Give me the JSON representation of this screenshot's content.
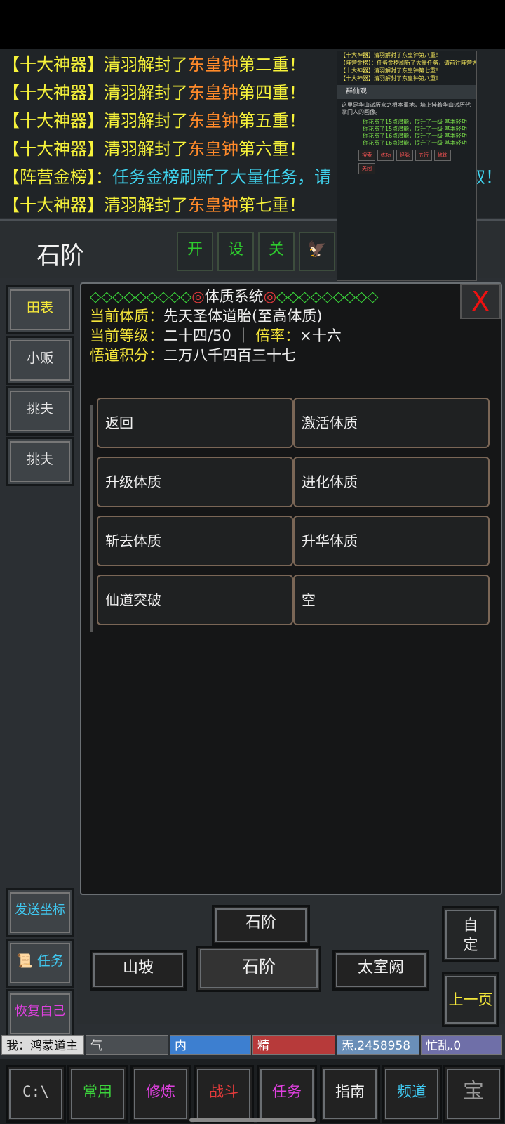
{
  "chat": {
    "lines": [
      {
        "prefix": "【十大神器】清羽解封了",
        "item": "东皇钟",
        "suffix": "第二重！"
      },
      {
        "prefix": "【十大神器】清羽解封了",
        "item": "东皇钟",
        "suffix": "第四重！"
      },
      {
        "prefix": "【十大神器】清羽解封了",
        "item": "东皇钟",
        "suffix": "第五重！"
      },
      {
        "prefix": "【十大神器】清羽解封了",
        "item": "东皇钟",
        "suffix": "第六重！"
      },
      {
        "prefix": "【阵营金榜】：",
        "item": "任务金榜刷新了大量任务，请",
        "suffix": "取！"
      },
      {
        "prefix": "【十大神器】清羽解封了",
        "item": "东皇钟",
        "suffix": "第七重！"
      }
    ]
  },
  "mini": {
    "rows": [
      "【十大神器】清羽解封了东皇钟第八重！",
      "【阵营金榜】：任务金榜刷新了大量任务，请前往阵营大厅接取！",
      "【十大神器】清羽解封了东皇钟第七重！",
      "【十大神器】清羽解封了东皇钟第八重！"
    ],
    "title": "群仙观",
    "desc": "这里是华山派历来之根本重地，墙上挂着华山派历代掌门人的画像。",
    "green": [
      "你花费了15点潜能，提升了一级 基本轻功",
      "你花费了15点潜能，提升了一级 基本轻功",
      "你花费了16点潜能，提升了一级 基本轻功",
      "你花费了16点潜能，提升了一级 基本轻功"
    ],
    "buttons": [
      "搜索",
      "练功",
      "经脉",
      "五行",
      "修炼",
      "关闭"
    ]
  },
  "location": {
    "title": "石阶",
    "buttons": [
      "开",
      "设",
      "关"
    ]
  },
  "sidebar": {
    "items": [
      "田表",
      "小贩",
      "挑夫",
      "挑夫"
    ],
    "bottom": [
      "发送坐标",
      "任务",
      "恢复自己"
    ]
  },
  "panel": {
    "header": {
      "diamonds_left": "◇◇◇◇◇◇◇◇◇",
      "circle": "◎",
      "title": "体质系统",
      "diamonds_right": "◇◇◇◇◇◇◇◇◇"
    },
    "close": "X",
    "lines": [
      {
        "label": "当前体质：",
        "value": "先天圣体道胎(至高体质)"
      },
      {
        "label": "当前等级：",
        "value": "二十四/50 ｜ ",
        "label2": "倍率：",
        "value2": "×十六"
      },
      {
        "label": "悟道积分：",
        "value": "二万八千四百三十七"
      }
    ],
    "buttons": [
      "返回",
      "激活体质",
      "升级体质",
      "进化体质",
      "斩去体质",
      "升华体质",
      "仙道突破",
      "空"
    ]
  },
  "nav": {
    "north": "石阶",
    "west": "山坡",
    "center": "石阶",
    "east": "太室阙"
  },
  "right": {
    "custom": "自\n定",
    "prev": "上一页"
  },
  "stats": {
    "me": "我：鸿蒙道主",
    "qi": "气",
    "nei": "内",
    "jing": "精",
    "money": "炁.2458958",
    "busy": "忙乱.0"
  },
  "bottom": {
    "cmd": "C:\\",
    "buttons": [
      "常用",
      "修炼",
      "战斗",
      "任务",
      "指南",
      "频道"
    ],
    "last": "宝"
  },
  "colors": {
    "yellow": "#f6f23a",
    "orange": "#ff8a2a",
    "green": "#2ecc2e",
    "red": "#e23b3b",
    "magenta": "#e040e0",
    "cyan": "#3fd3ee"
  }
}
